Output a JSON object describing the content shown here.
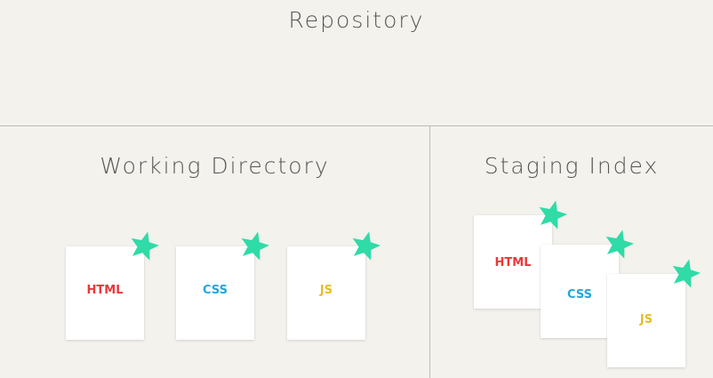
{
  "colors": {
    "background": "#f3f2ed",
    "divider": "#bdbdb8",
    "title_text": "#555555",
    "star": "#2fdba7",
    "html": "#e8383c",
    "css": "#21a8d8",
    "js": "#e6bd26"
  },
  "repository": {
    "title": "Repository"
  },
  "working_directory": {
    "title": "Working Directory",
    "files": [
      {
        "label": "HTML",
        "color": "#e8383c",
        "modified": true
      },
      {
        "label": "CSS",
        "color": "#21a8d8",
        "modified": true
      },
      {
        "label": "JS",
        "color": "#e6bd26",
        "modified": true
      }
    ]
  },
  "staging_index": {
    "title": "Staging Index",
    "files": [
      {
        "label": "HTML",
        "color": "#e8383c",
        "modified": true
      },
      {
        "label": "CSS",
        "color": "#21a8d8",
        "modified": true
      },
      {
        "label": "JS",
        "color": "#e6bd26",
        "modified": true
      }
    ]
  },
  "icons": {
    "modified_marker": "star-icon"
  }
}
